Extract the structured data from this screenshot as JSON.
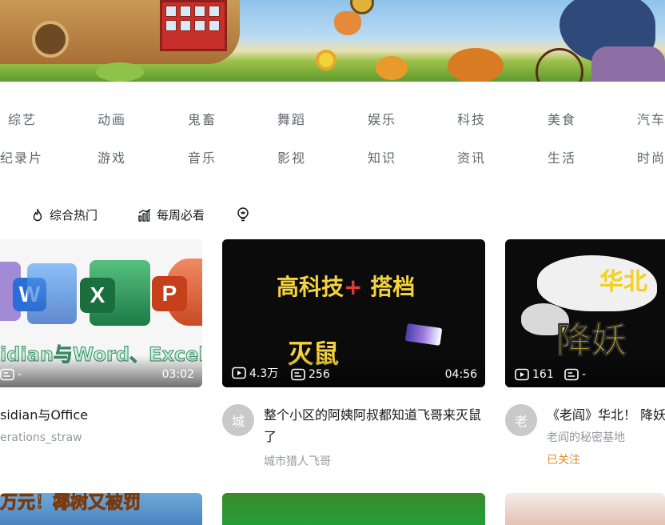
{
  "categories": {
    "row1": [
      "综艺",
      "动画",
      "鬼畜",
      "舞蹈",
      "娱乐",
      "科技",
      "美食",
      "汽车"
    ],
    "row2": [
      "纪录片",
      "游戏",
      "音乐",
      "影视",
      "知识",
      "资讯",
      "生活",
      "时尚"
    ]
  },
  "hot_tabs": {
    "comprehensive": "综合热门",
    "weekly": "每周必看"
  },
  "cards": [
    {
      "thumb_caption": "idian与Word、Excel、P",
      "views": "",
      "danmaku": "-",
      "duration": "03:02",
      "title": "sidian与Office",
      "author": "erations_straw",
      "office_letters": [
        "W",
        "X",
        "P"
      ]
    },
    {
      "thumb_top_a": "高科技",
      "thumb_top_plus": "+",
      "thumb_top_b": "搭档",
      "thumb_bottom": "灭鼠",
      "views": "4.3万",
      "danmaku": "256",
      "duration": "04:56",
      "avatar_char": "城",
      "title": "整个小区的阿姨阿叔都知道飞哥来灭鼠了",
      "author": "城市猎人飞哥"
    },
    {
      "thumb_top": "华北",
      "thumb_bottom": "降妖",
      "views": "161",
      "danmaku": "-",
      "avatar_char": "老",
      "title": "《老阎》华北！ 降妖",
      "author": "老阎的秘密基地",
      "followed": "已关注"
    }
  ],
  "bottom_row": {
    "thumb1_caption": "万元！椰树又被罚"
  }
}
